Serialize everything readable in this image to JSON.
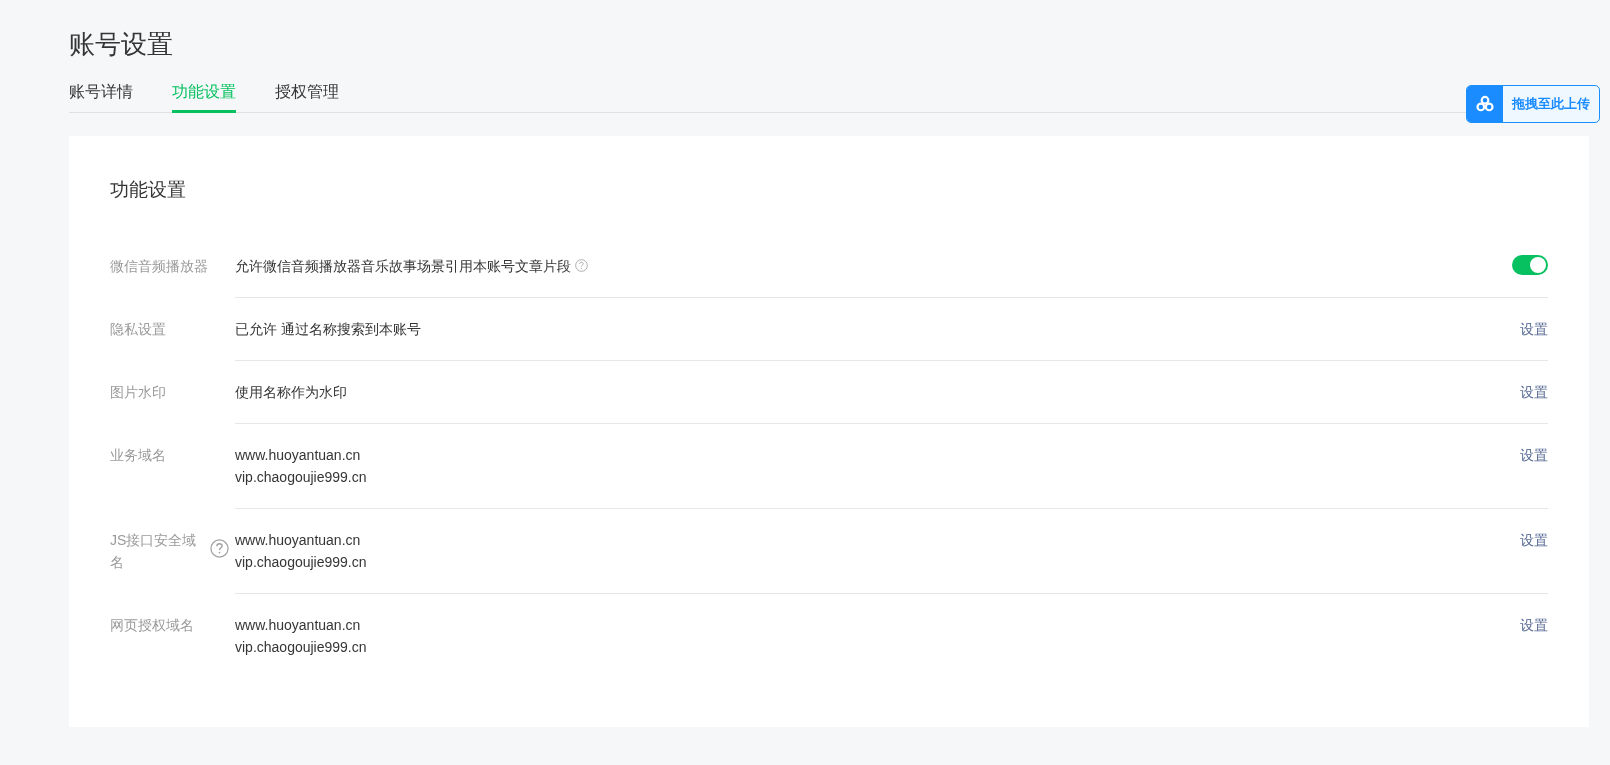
{
  "page_title": "账号设置",
  "tabs": [
    {
      "label": "账号详情",
      "selected": false
    },
    {
      "label": "功能设置",
      "selected": true
    },
    {
      "label": "授权管理",
      "selected": false
    }
  ],
  "upload_button": {
    "label": "拖拽至此上传"
  },
  "card": {
    "title": "功能设置",
    "rows": [
      {
        "kind": "toggle",
        "label": "微信音频播放器",
        "lines": [
          "允许微信音频播放器音乐故事场景引用本账号文章片段"
        ],
        "help": true,
        "label_help": false,
        "on": true
      },
      {
        "kind": "link",
        "label": "隐私设置",
        "lines": [
          "已允许 通过名称搜索到本账号"
        ],
        "help": false,
        "label_help": false,
        "action": "设置"
      },
      {
        "kind": "link",
        "label": "图片水印",
        "lines": [
          "使用名称作为水印"
        ],
        "help": false,
        "label_help": false,
        "action": "设置"
      },
      {
        "kind": "link",
        "label": "业务域名",
        "lines": [
          "www.huoyantuan.cn",
          "vip.chaogoujie999.cn"
        ],
        "help": false,
        "label_help": false,
        "action": "设置"
      },
      {
        "kind": "link",
        "label": "JS接口安全域名",
        "lines": [
          "www.huoyantuan.cn",
          "vip.chaogoujie999.cn"
        ],
        "help": false,
        "label_help": true,
        "action": "设置"
      },
      {
        "kind": "link",
        "label": "网页授权域名",
        "lines": [
          "www.huoyantuan.cn",
          "vip.chaogoujie999.cn"
        ],
        "help": false,
        "label_help": false,
        "action": "设置"
      }
    ]
  }
}
